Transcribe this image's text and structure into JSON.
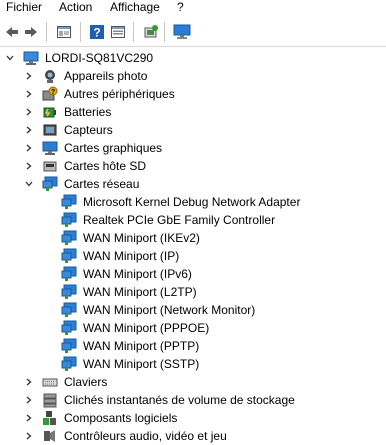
{
  "menu": {
    "items": [
      "Fichier",
      "Action",
      "Affichage",
      "?"
    ]
  },
  "toolbar": {
    "buttons": [
      "back-arrow-icon",
      "forward-arrow-icon",
      "properties-icon",
      "help-icon",
      "view-icon",
      "update-driver-icon",
      "computer-monitor-icon"
    ]
  },
  "tree": {
    "root": {
      "label": "LORDI-SQ81VC290",
      "expander": "⌄"
    },
    "categories_top": [
      {
        "label": "Appareils photo",
        "icon": "camera-icon"
      },
      {
        "label": "Autres périphériques",
        "icon": "unknown-device-icon"
      },
      {
        "label": "Batteries",
        "icon": "battery-icon"
      },
      {
        "label": "Capteurs",
        "icon": "sensor-icon"
      },
      {
        "label": "Cartes graphiques",
        "icon": "display-adapter-icon"
      },
      {
        "label": "Cartes hôte SD",
        "icon": "sd-host-icon"
      }
    ],
    "network": {
      "label": "Cartes réseau",
      "icon": "network-adapter-icon",
      "children": [
        "Microsoft Kernel Debug Network Adapter",
        "Realtek PCIe GbE Family Controller",
        "WAN Miniport (IKEv2)",
        "WAN Miniport (IP)",
        "WAN Miniport (IPv6)",
        "WAN Miniport (L2TP)",
        "WAN Miniport (Network Monitor)",
        "WAN Miniport (PPPOE)",
        "WAN Miniport (PPTP)",
        "WAN Miniport (SSTP)"
      ]
    },
    "categories_bottom": [
      {
        "label": "Claviers",
        "icon": "keyboard-icon"
      },
      {
        "label": "Clichés instantanés de volume de stockage",
        "icon": "storage-snapshot-icon"
      },
      {
        "label": "Composants logiciels",
        "icon": "software-component-icon"
      },
      {
        "label": "Contrôleurs audio, vidéo et jeu",
        "icon": "audio-controller-icon"
      }
    ]
  },
  "colors": {
    "accent": "#1e78c8",
    "monitor": "#2a7fd4",
    "separator": "#c8c8c8"
  }
}
